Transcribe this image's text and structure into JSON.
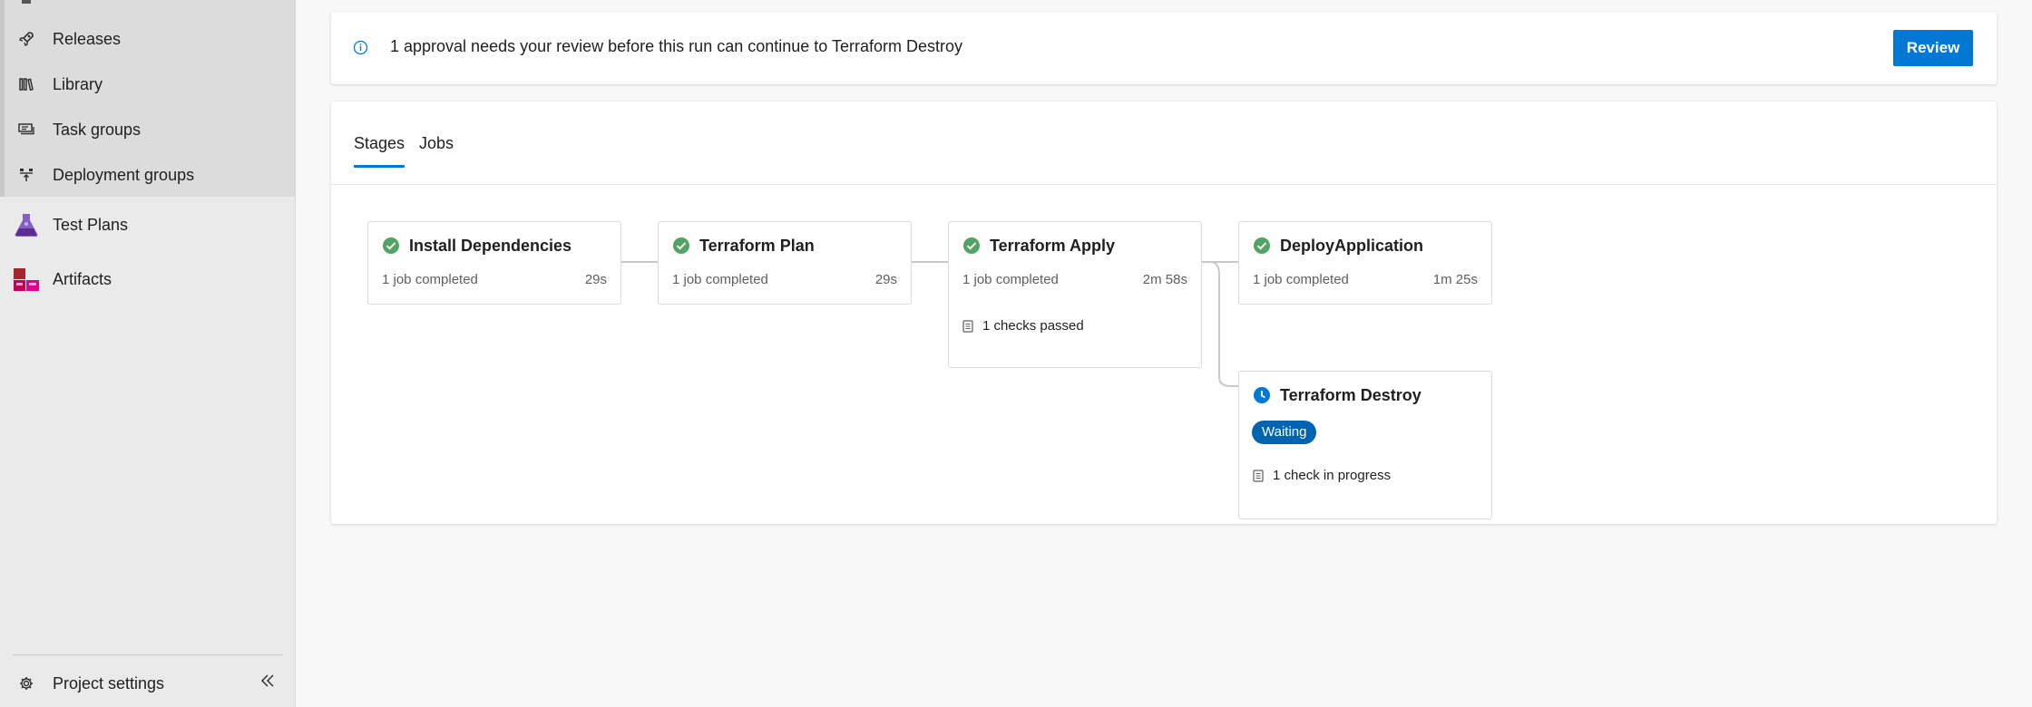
{
  "sidebar": {
    "items": [
      {
        "label": "Releases",
        "icon": "rocket-icon"
      },
      {
        "label": "Library",
        "icon": "library-icon"
      },
      {
        "label": "Task groups",
        "icon": "task-groups-icon"
      },
      {
        "label": "Deployment groups",
        "icon": "deployment-groups-icon"
      },
      {
        "label": "Test Plans",
        "icon": "test-plans-icon",
        "color": "#8661c5"
      },
      {
        "label": "Artifacts",
        "icon": "artifacts-icon",
        "color": "#d63f71"
      }
    ],
    "footer": {
      "label": "Project settings",
      "icon": "gear-icon",
      "collapse_icon": "double-chevron-left-icon"
    }
  },
  "banner": {
    "icon": "info-icon",
    "text": "1 approval needs your review before this run can continue to Terraform Destroy",
    "button_label": "Review",
    "accent": "#0078d4"
  },
  "tabs": [
    {
      "label": "Stages",
      "active": true
    },
    {
      "label": "Jobs",
      "active": false
    }
  ],
  "stages": [
    {
      "name": "Install Dependencies",
      "status": "succeeded",
      "jobs": "1 job completed",
      "duration": "29s"
    },
    {
      "name": "Terraform Plan",
      "status": "succeeded",
      "jobs": "1 job completed",
      "duration": "29s"
    },
    {
      "name": "Terraform Apply",
      "status": "succeeded",
      "jobs": "1 job completed",
      "duration": "2m 58s",
      "checks": "1 checks passed"
    },
    {
      "name": "DeployApplication",
      "status": "succeeded",
      "jobs": "1 job completed",
      "duration": "1m 25s"
    },
    {
      "name": "Terraform Destroy",
      "status": "waiting",
      "badge": "Waiting",
      "checks": "1 check in progress"
    }
  ],
  "colors": {
    "success": "#55a362",
    "waiting": "#0078d4",
    "badge": "#0064b0"
  }
}
